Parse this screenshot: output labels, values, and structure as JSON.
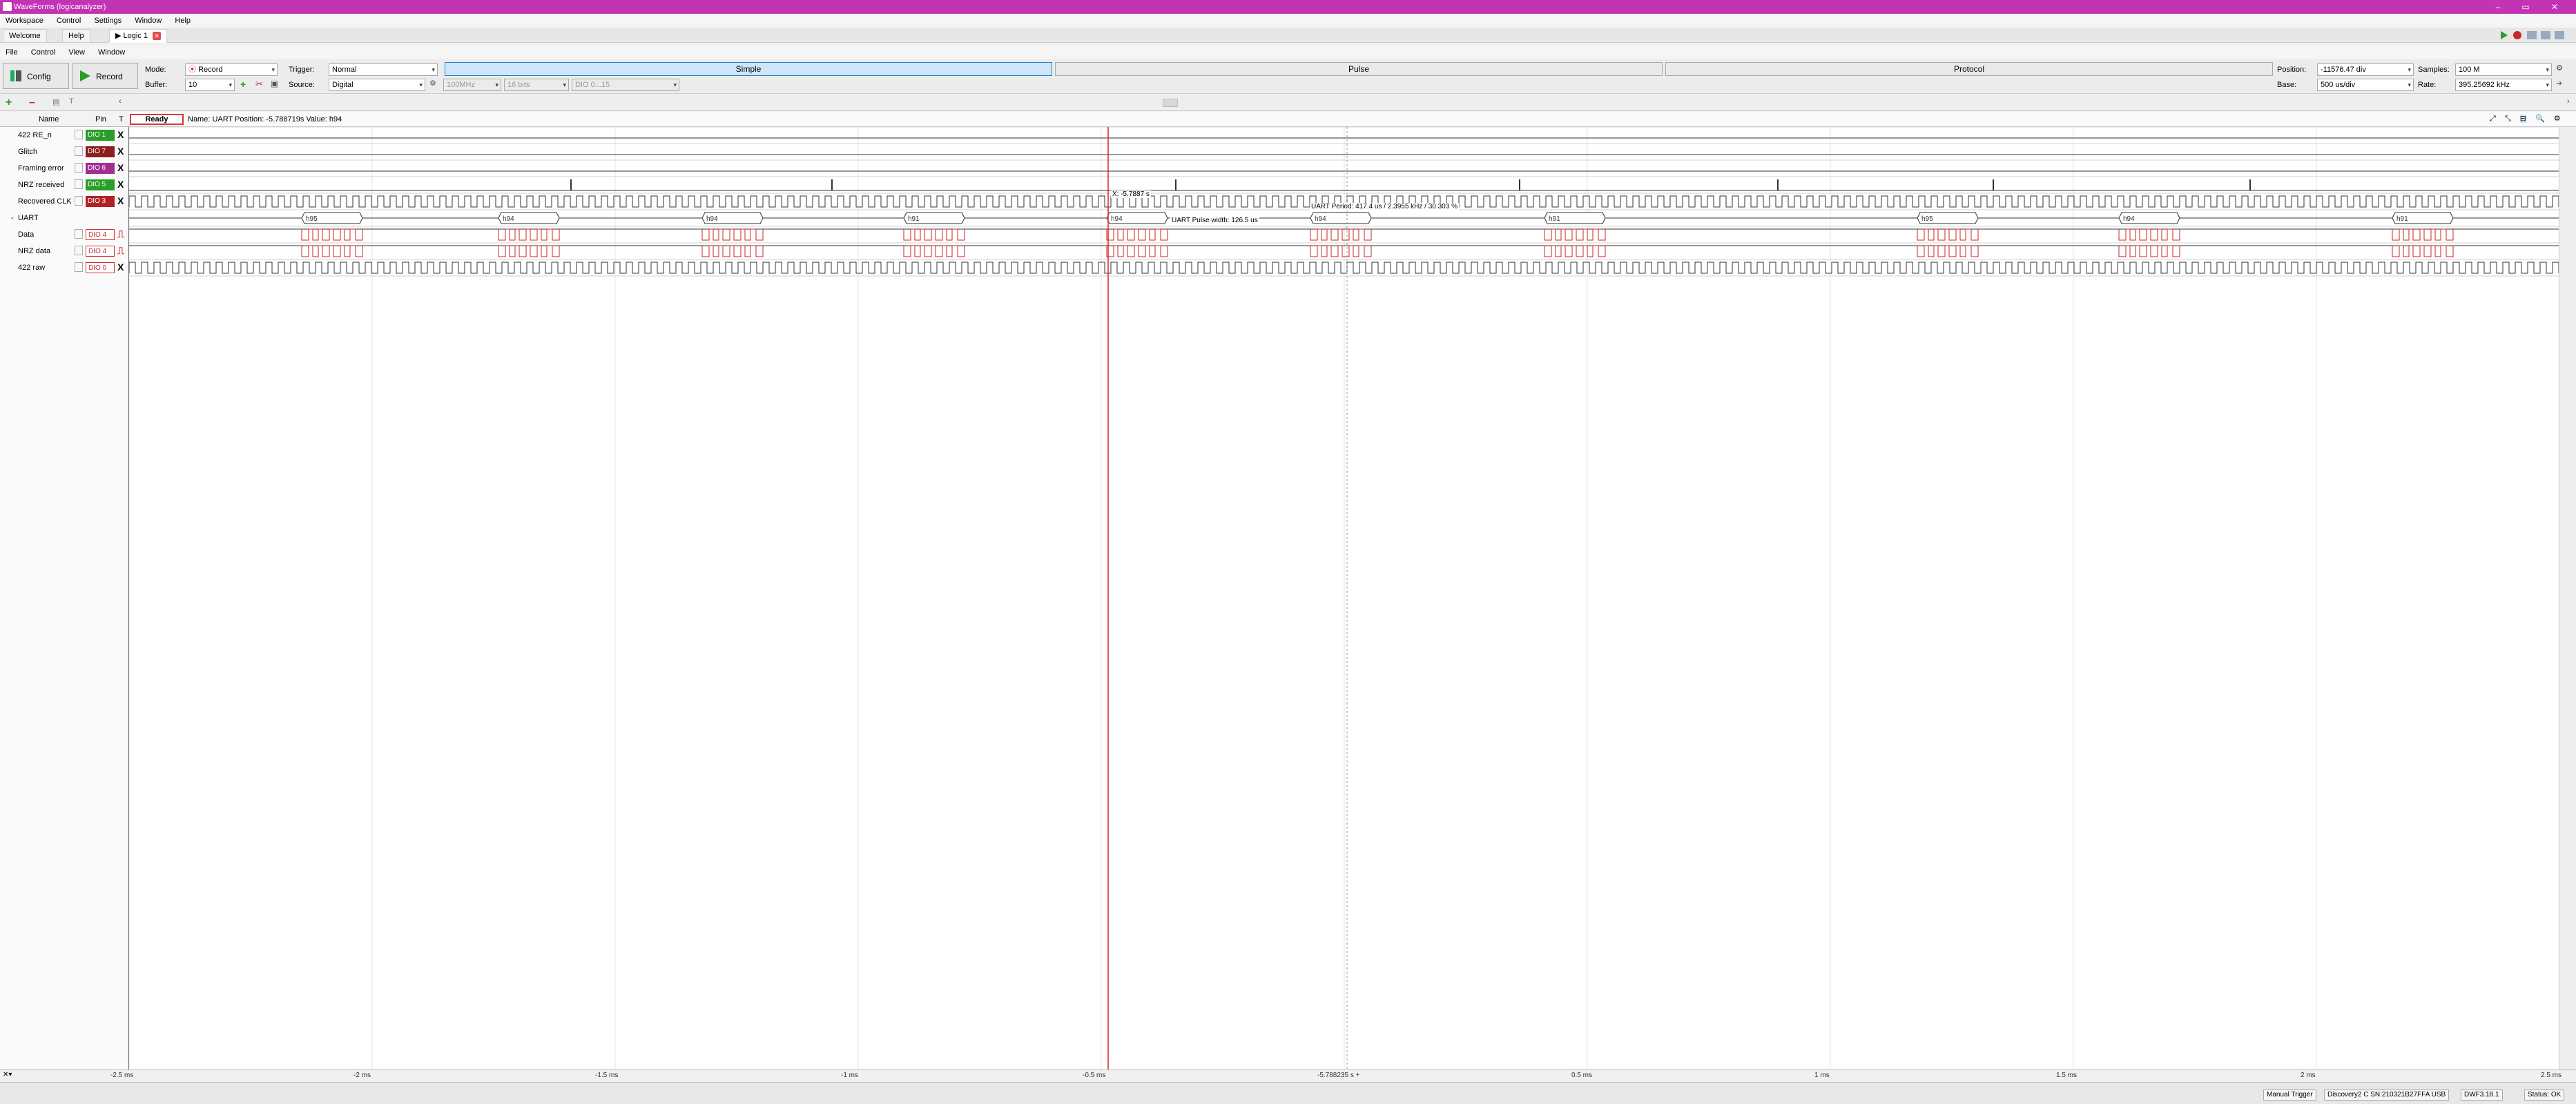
{
  "window": {
    "title": "WaveForms (logicanalyzer)",
    "minimize": "–",
    "maximize": "▭",
    "close": "✕"
  },
  "menu1": [
    "Workspace",
    "Control",
    "Settings",
    "Window",
    "Help"
  ],
  "tabs": [
    {
      "label": "Welcome",
      "active": false
    },
    {
      "label": "Help",
      "active": false
    },
    {
      "label": "Logic 1",
      "active": true
    }
  ],
  "menu2": [
    "File",
    "Control",
    "View",
    "Window"
  ],
  "toolbar": {
    "config": "Config",
    "record": "Record",
    "mode_label": "Mode:",
    "mode_value": "Record",
    "buffer_label": "Buffer:",
    "buffer_value": "10",
    "trigger_label": "Trigger:",
    "trigger_value": "Normal",
    "source_label": "Source:",
    "source_value": "Digital",
    "dis1": "100MHz",
    "dis2": "16 bits",
    "dis3": "DIO 0...15",
    "mode_tabs": [
      "Simple",
      "Pulse",
      "Protocol"
    ],
    "position_label": "Position:",
    "position_value": "-11576.47 div",
    "base_label": "Base:",
    "base_value": "500 us/div",
    "samples_label": "Samples:",
    "samples_value": "100 M",
    "rate_label": "Rate:",
    "rate_value": "395.25692 kHz"
  },
  "grid": {
    "header_name": "Name",
    "header_pin": "Pin",
    "header_t": "T"
  },
  "status": {
    "ready": "Ready",
    "info": "Name: UART  Position: -5.788719s  Value: h94"
  },
  "signals": [
    {
      "name": "422 RE_n",
      "pin": "DIO 1",
      "color": "#2a9d2a",
      "val": "X"
    },
    {
      "name": "Glitch",
      "pin": "DIO 7",
      "color": "#8b1e1e",
      "val": "X"
    },
    {
      "name": "Framing error",
      "pin": "DIO 6",
      "color": "#a12f93",
      "val": "X"
    },
    {
      "name": "NRZ received",
      "pin": "DIO 5",
      "color": "#2a9d2a",
      "val": "X"
    },
    {
      "name": "Recovered CLK",
      "pin": "DIO 3",
      "color": "#b22222",
      "val": "X"
    },
    {
      "name": "UART",
      "pin": "",
      "color": "",
      "val": ""
    },
    {
      "name": "Data",
      "pin": "DIO 4",
      "color": "#e06060",
      "val": "⎍"
    },
    {
      "name": "NRZ data",
      "pin": "DIO 4",
      "color": "#e06060",
      "val": "⎍"
    },
    {
      "name": "422 raw",
      "pin": "DIO 0",
      "color": "#e06060",
      "val": "X"
    }
  ],
  "uart_values": [
    "h95",
    "h94",
    "h94",
    "h91",
    "h94",
    "h94",
    "h91",
    "h95",
    "h94",
    "h91"
  ],
  "annotations": {
    "cursor": "X: -5.7887 s",
    "period": "UART Period: 417.4 us / 2.3955 kHz / 30.303 %",
    "pulse": "UART Pulse width: 126.5 us"
  },
  "time_axis": [
    "-2.5 ms",
    "-2 ms",
    "-1.5 ms",
    "-1 ms",
    "-0.5 ms",
    "-5.788235 s +",
    "0.5 ms",
    "1 ms",
    "1.5 ms",
    "2 ms",
    "2.5 ms"
  ],
  "statusbar": {
    "manual_trigger": "Manual Trigger",
    "device": "Discovery2 C SN:210321B27FFA USB",
    "version": "DWF3.18.1",
    "status": "Status: OK"
  },
  "colors": {
    "titlebar": "#c234b4",
    "cursor": "#e02020",
    "uart": "#d02020"
  }
}
